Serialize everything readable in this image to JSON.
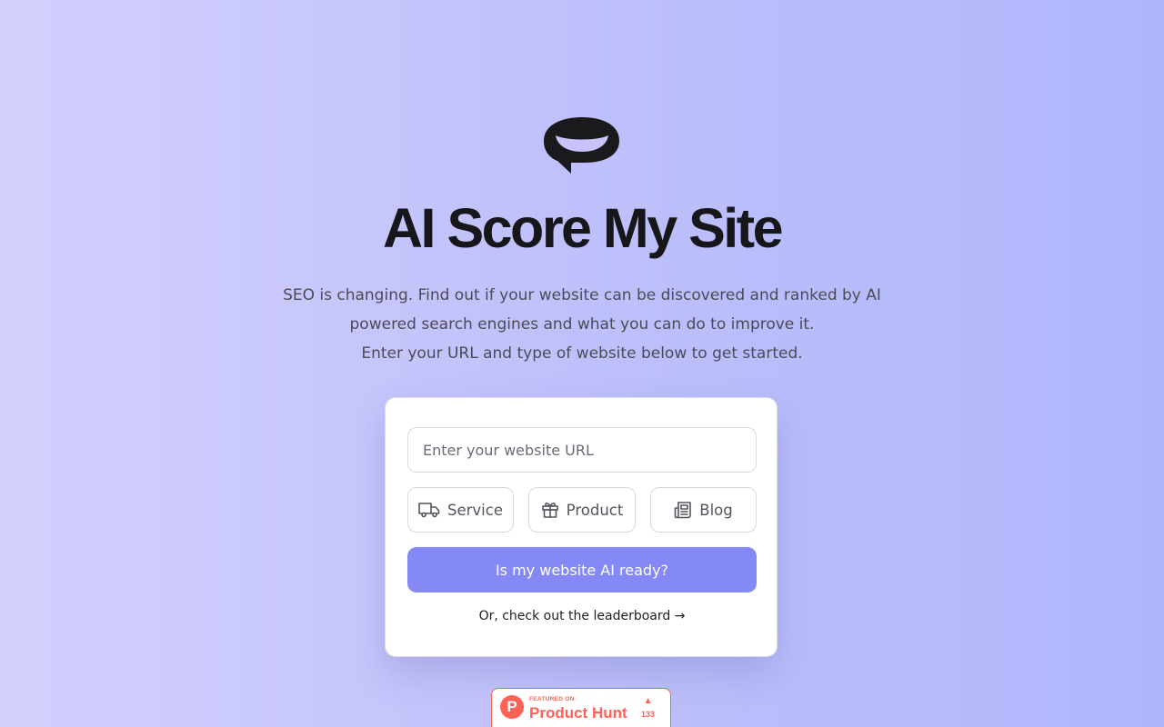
{
  "logo": {
    "icon": "speech-bubble-logo-icon"
  },
  "hero": {
    "title": "AI Score My Site",
    "description_line1": "SEO is changing. Find out if your website can be discovered and ranked by AI powered search engines and what you can do to improve it.",
    "description_line2": "Enter your URL and type of website below to get started."
  },
  "form": {
    "url_placeholder": "Enter your website URL",
    "url_value": "",
    "types": [
      {
        "label": "Service",
        "icon": "truck-icon"
      },
      {
        "label": "Product",
        "icon": "gift-icon"
      },
      {
        "label": "Blog",
        "icon": "newspaper-icon"
      }
    ],
    "submit_label": "Is my website AI ready?",
    "leaderboard_link": "Or, check out the leaderboard →"
  },
  "product_hunt": {
    "featured": "FEATURED ON",
    "name": "Product Hunt",
    "logo_letter": "P",
    "upvote_icon": "triangle-up-icon",
    "votes": "133"
  },
  "colors": {
    "accent": "#8489f6",
    "product_hunt": "#ff6154",
    "title": "#17171b"
  }
}
